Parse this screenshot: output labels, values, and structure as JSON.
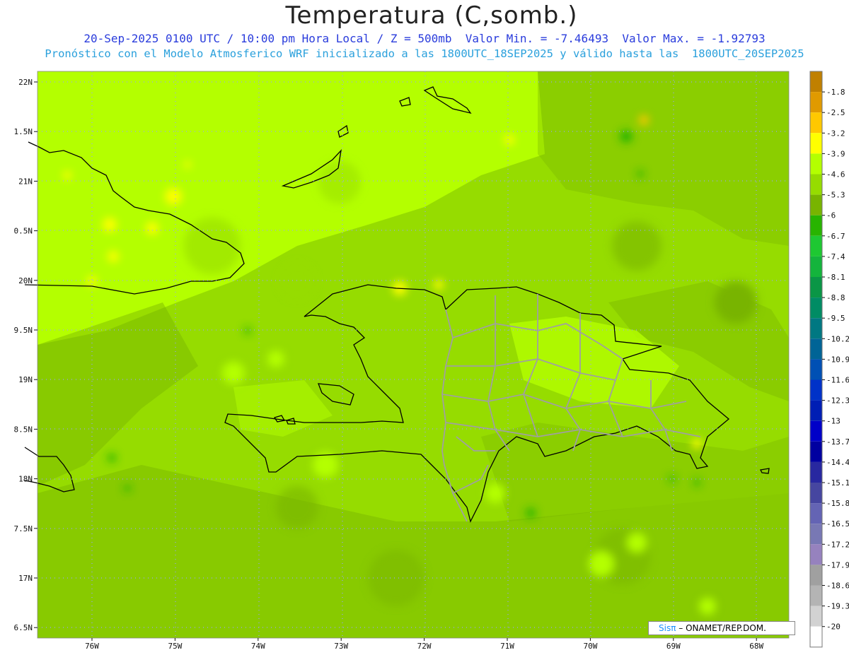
{
  "header": {
    "title": "Temperatura (C,somb.)",
    "subtitle_1": "20-Sep-2025 0100 UTC / 10:00 pm Hora Local / Z = 500mb  Valor Min. = -7.46493  Valor Max. = -1.92793",
    "subtitle_2": "Pronóstico con el Modelo Atmosferico WRF inicializado a las 1800UTC_18SEP2025 y válido hasta las  1800UTC_20SEP2025"
  },
  "map": {
    "lat_labels": [
      "22N",
      "1.5N",
      "21N",
      "0.5N",
      "20N",
      "9.5N",
      "19N",
      "8.5N",
      "18N",
      "7.5N",
      "17N",
      "6.5N"
    ],
    "lon_labels": [
      "76W",
      "75W",
      "74W",
      "73W",
      "72W",
      "71W",
      "70W",
      "69W",
      "68W"
    ]
  },
  "colorbar": {
    "labels": [
      "-1.8",
      "-2.5",
      "-3.2",
      "-3.9",
      "-4.6",
      "-5.3",
      "-6",
      "-6.7",
      "-7.4",
      "-8.1",
      "-8.8",
      "-9.5",
      "-10.2",
      "-10.9",
      "-11.6",
      "-12.3",
      "-13",
      "-13.7",
      "-14.4",
      "-15.1",
      "-15.8",
      "-16.5",
      "-17.2",
      "-17.9",
      "-18.6",
      "-19.3",
      "-20"
    ],
    "colors": [
      "#c08000",
      "#e09a00",
      "#ffc800",
      "#ffff00",
      "#b4ff00",
      "#96dc00",
      "#78b400",
      "#28b400",
      "#1ec832",
      "#14b43c",
      "#0a9646",
      "#008c64",
      "#007882",
      "#006496",
      "#0050b4",
      "#0032c8",
      "#001eb4",
      "#0000c8",
      "#0000a0",
      "#2828a0",
      "#4646a0",
      "#6464b4",
      "#7878b4",
      "#9682be",
      "#a0a0a0",
      "#b4b4b4",
      "#d2d2d2",
      "#ffffff"
    ]
  },
  "credit": {
    "brand": "Sisπ",
    "text": "– ONAMET/REP.DOM."
  }
}
